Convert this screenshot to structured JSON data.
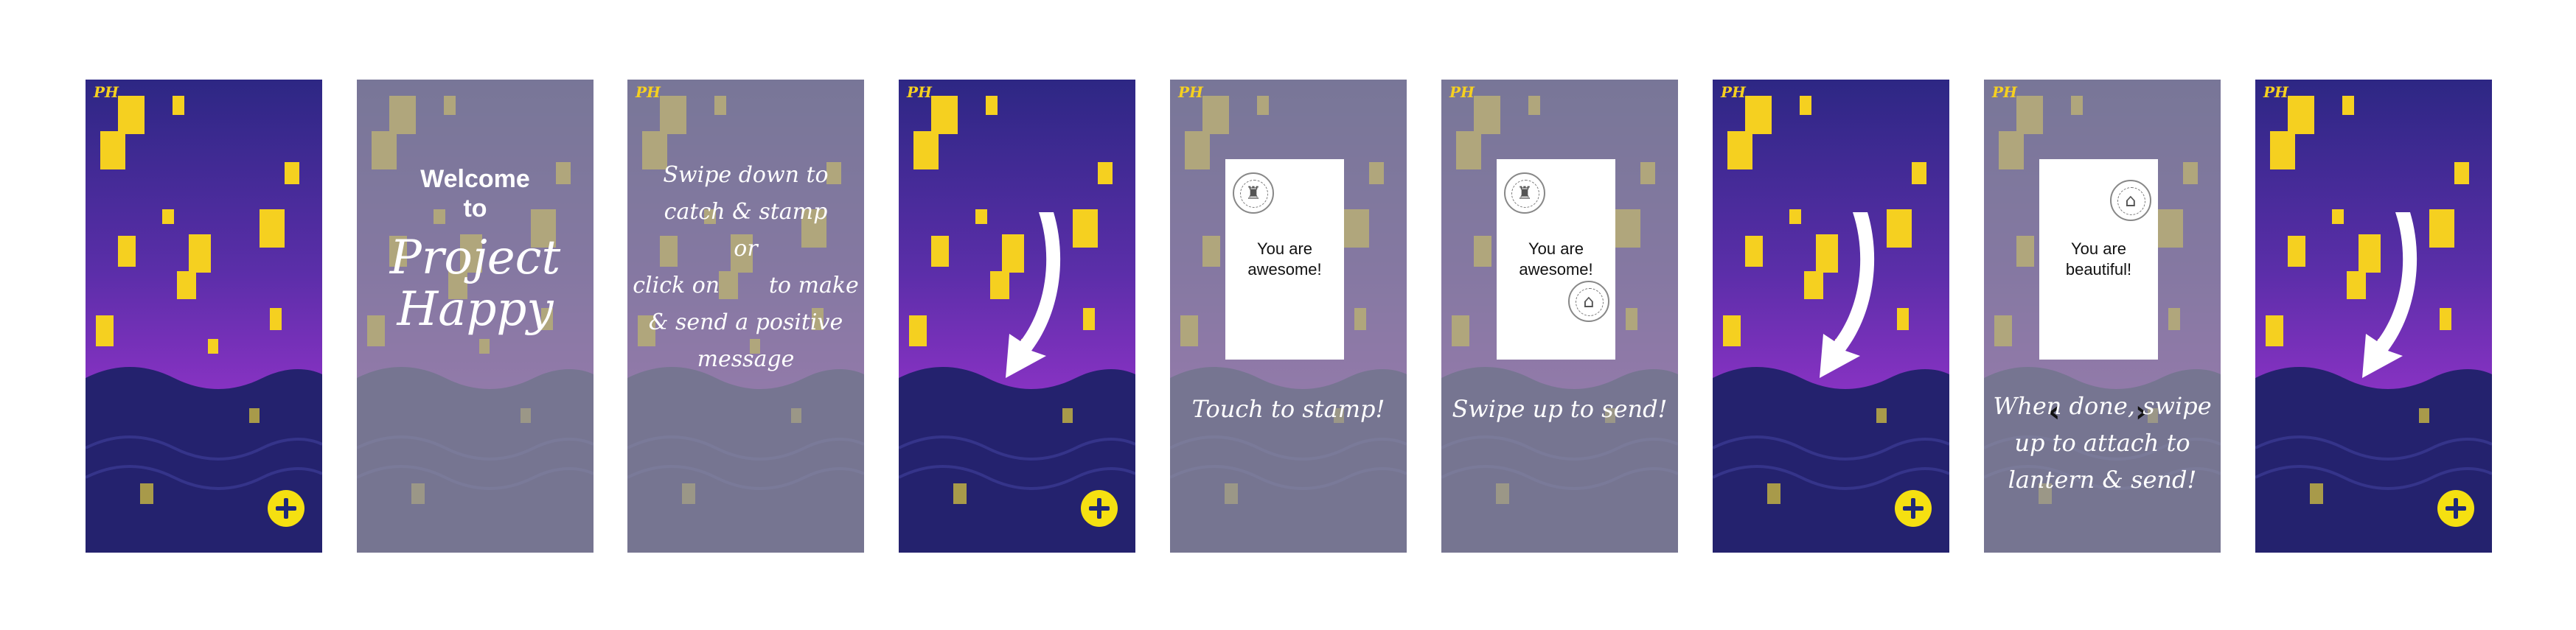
{
  "app": {
    "logo_text": "PH",
    "colors": {
      "sky_top": "#2d2784",
      "sky_bottom": "#9233c9",
      "sea": "#24226e",
      "lantern": "#f5d020",
      "button": "#f5e011"
    }
  },
  "screens": [
    {
      "type": "main",
      "add_button_icon": "plus-icon"
    },
    {
      "type": "welcome",
      "welcome_line1": "Welcome",
      "welcome_line2": "to",
      "project_line1": "Project",
      "project_line2": "Happy"
    },
    {
      "type": "instructions",
      "lines": [
        "Swipe down to",
        "catch & stamp",
        "or",
        "click on       to make",
        "& send a positive",
        "message"
      ]
    },
    {
      "type": "swipe-down",
      "add_button_icon": "plus-icon"
    },
    {
      "type": "stamp",
      "message_line1": "You are",
      "message_line2": "awesome!",
      "caption": "Touch to stamp!"
    },
    {
      "type": "send",
      "message_line1": "You are",
      "message_line2": "awesome!",
      "caption": "Swipe up to send!"
    },
    {
      "type": "swipe-down",
      "add_button_icon": "plus-icon"
    },
    {
      "type": "compose",
      "message_line1": "You are",
      "message_line2": "beautiful!",
      "prev_glyph": "‹",
      "next_glyph": "›",
      "caption_lines": [
        "When done, swipe",
        "up to attach to",
        "lantern & send!"
      ]
    },
    {
      "type": "swipe-down",
      "add_button_icon": "plus-icon"
    }
  ]
}
